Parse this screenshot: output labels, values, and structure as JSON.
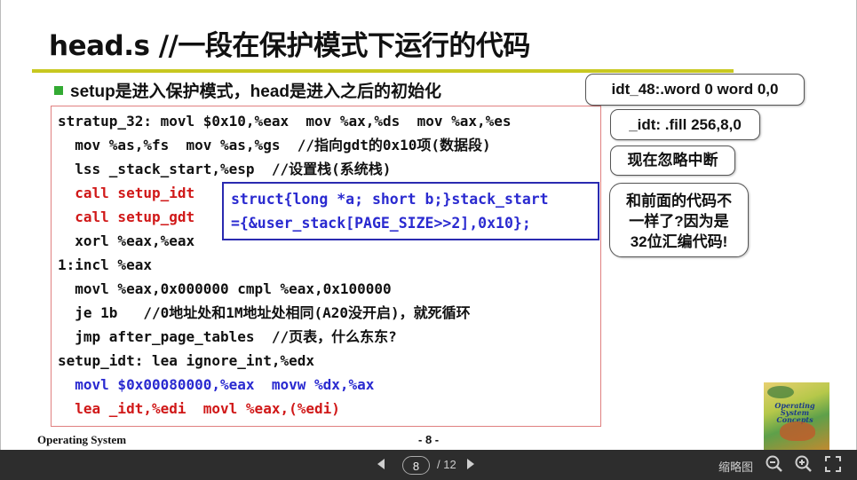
{
  "slide": {
    "title": "head.s //一段在保护模式下运行的代码",
    "bullet": "setup是进入保护模式，head是进入之后的初始化",
    "code_lines": [
      {
        "text": "stratup_32: movl $0x10,%eax  mov %ax,%ds  mov %ax,%es",
        "color": "black"
      },
      {
        "text": "  mov %as,%fs  mov %as,%gs  //指向gdt的0x10项(数据段)",
        "color": "black"
      },
      {
        "text": "  lss _stack_start,%esp  //设置栈(系统栈)",
        "color": "black"
      },
      {
        "text": "  call setup_idt",
        "color": "red"
      },
      {
        "text": "  call setup_gdt",
        "color": "red"
      },
      {
        "text": "  xorl %eax,%eax",
        "color": "black"
      },
      {
        "text": "1:incl %eax",
        "color": "black"
      },
      {
        "text": "  movl %eax,0x000000 cmpl %eax,0x100000",
        "color": "black"
      },
      {
        "text": "  je 1b   //0地址处和1M地址处相同(A20没开启)，就死循环",
        "color": "black"
      },
      {
        "text": "  jmp after_page_tables  //页表，什么东东?",
        "color": "black"
      },
      {
        "text": "setup_idt: lea ignore_int,%edx",
        "color": "black"
      },
      {
        "text": "  movl $0x00080000,%eax  movw %dx,%ax",
        "color": "blue"
      },
      {
        "text": "  lea _idt,%edi  movl %eax,(%edi)",
        "color": "red"
      }
    ],
    "popup_lines": [
      "struct{long *a; short b;}stack_start",
      "={&user_stack[PAGE_SIZE>>2],0x10};"
    ],
    "callouts": {
      "idt48": "idt_48:.word 0  word 0,0",
      "idt": "_idt: .fill 256,8,0",
      "ignore": "现在忽略中断",
      "note_line1": "和前面的代码不",
      "note_line2": "一样了?因为是",
      "note_line3": "32位汇编代码!"
    },
    "footer_left": "Operating System",
    "footer_page": "- 8 -",
    "book_title": "Operating System Concepts"
  },
  "toolbar": {
    "current_page": "8",
    "total_pages": "/ 12",
    "thumbnail_label": "缩略图"
  },
  "colors": {
    "accent_rule": "#c8c820",
    "bullet_square": "#33aa33",
    "code_red": "#d01818",
    "code_blue": "#2a2ad0",
    "toolbar_bg": "#2d2d2d"
  }
}
